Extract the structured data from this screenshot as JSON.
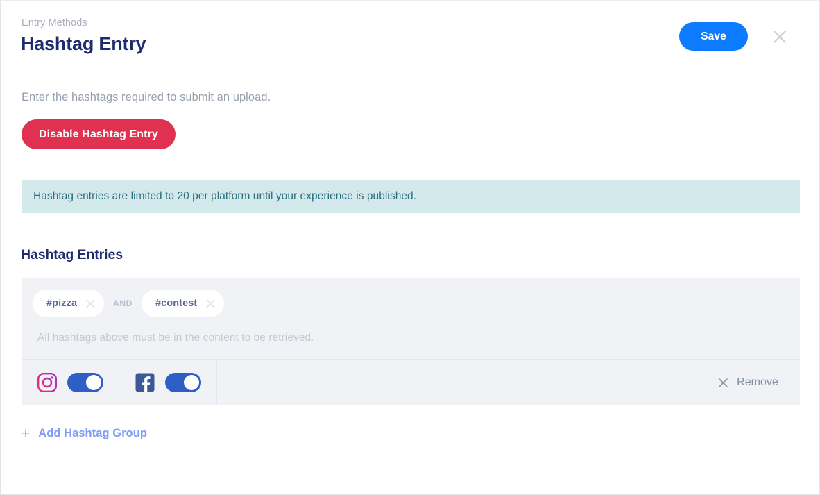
{
  "header": {
    "breadcrumb": "Entry Methods",
    "title": "Hashtag Entry",
    "save_label": "Save",
    "close_icon": "close-icon"
  },
  "intro": {
    "description": "Enter the hashtags required to submit an upload.",
    "disable_label": "Disable Hashtag Entry"
  },
  "info_banner": {
    "text": "Hashtag entries are limited to 20 per platform until your experience is published."
  },
  "section": {
    "title": "Hashtag Entries"
  },
  "group": {
    "chips": [
      {
        "label": "#pizza",
        "remove_icon": "close-icon"
      },
      {
        "label": "#contest",
        "remove_icon": "close-icon"
      }
    ],
    "conjunction": "AND",
    "hint": "All hashtags above must be in the content to be retrieved.",
    "platforms": [
      {
        "name": "instagram",
        "icon": "instagram-icon",
        "enabled": true
      },
      {
        "name": "facebook",
        "icon": "facebook-icon",
        "enabled": true
      }
    ],
    "remove": {
      "icon": "close-icon",
      "label": "Remove"
    }
  },
  "add_group": {
    "plus": "+",
    "label": "Add Hashtag Group"
  },
  "colors": {
    "accent_blue": "#0d7bff",
    "danger_red": "#e03250",
    "title_navy": "#1f2d6e",
    "banner_bg": "#d3e9ec",
    "banner_text": "#2c6f80",
    "toggle_on": "#2f5fc4",
    "link_blue": "#7e9bf5",
    "card_bg": "#f1f2f6",
    "instagram_pink": "#c32aa3",
    "facebook_blue": "#3b5998"
  }
}
